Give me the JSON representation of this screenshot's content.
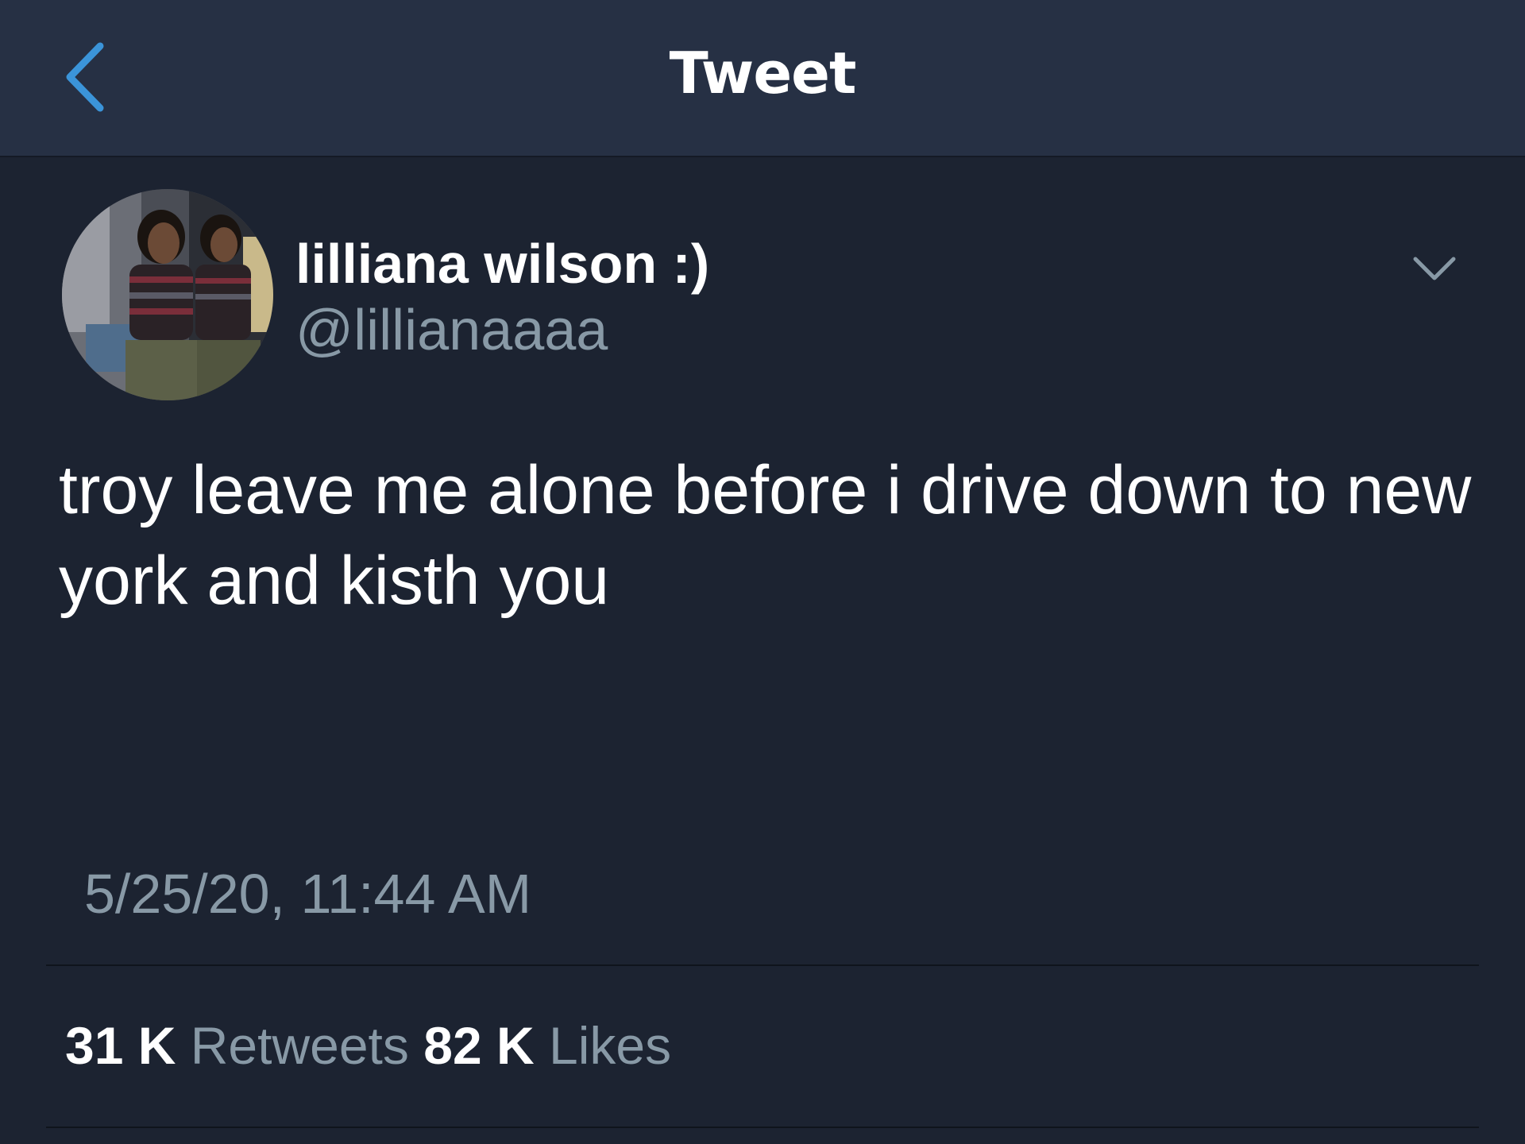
{
  "header": {
    "title": "Tweet",
    "back_icon": "chevron-left-icon",
    "accent_color": "#3b94d9"
  },
  "tweet": {
    "display_name": "lilliana wilson :)",
    "handle": "@lillianaaaa",
    "text": "troy leave me alone before i drive down to new york and kisth you",
    "timestamp": "5/25/20, 11:44 AM",
    "menu_icon": "chevron-down-icon"
  },
  "stats": {
    "retweets_count": "31 K",
    "retweets_label": "Retweets",
    "likes_count": "82 K",
    "likes_label": "Likes"
  },
  "colors": {
    "background": "#1c2331",
    "header_background": "#263044",
    "secondary_text": "#8899a6",
    "primary_text": "#ffffff"
  }
}
